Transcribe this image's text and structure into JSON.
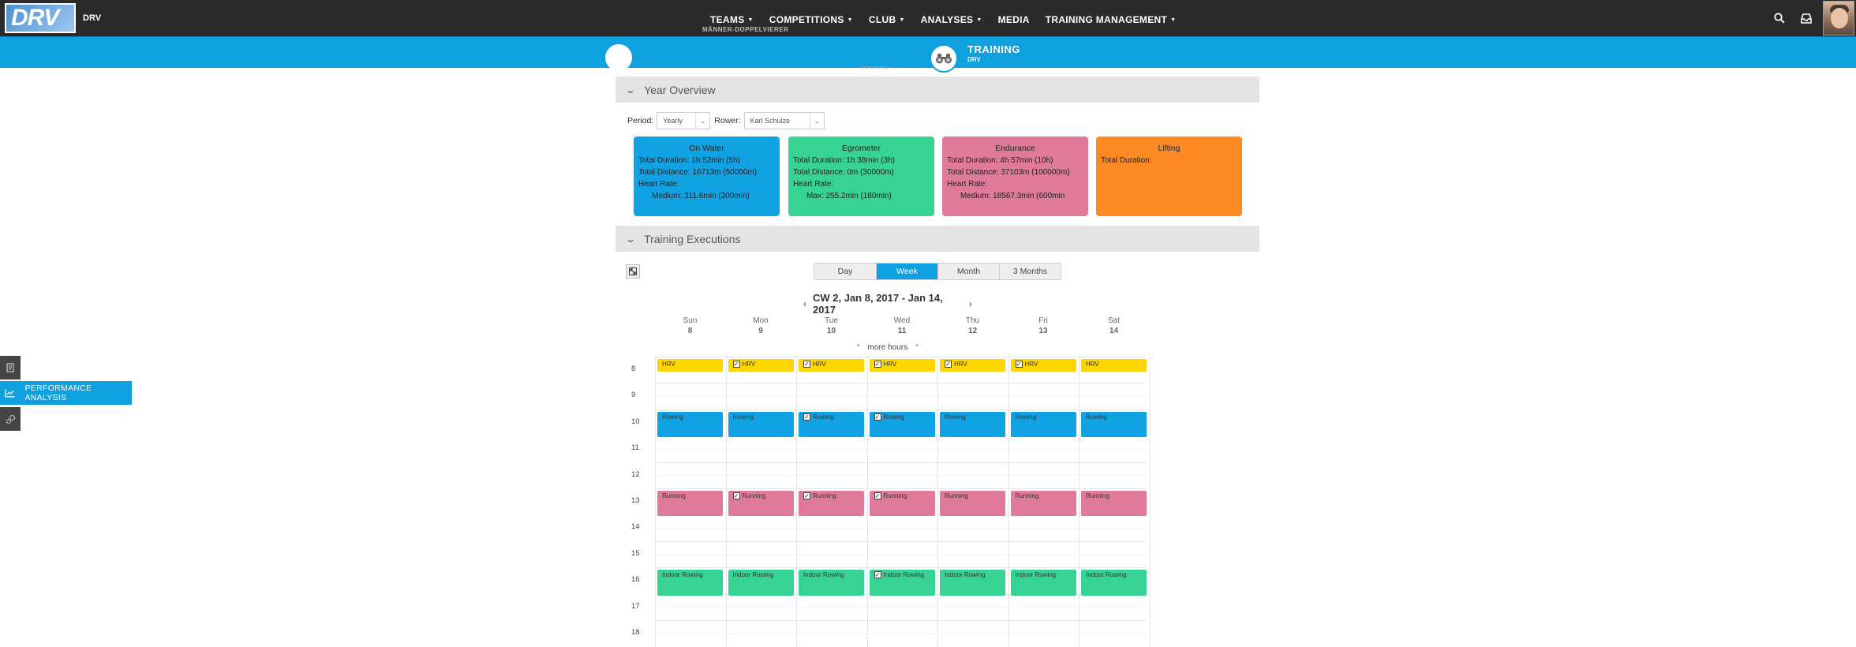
{
  "header": {
    "logo_text": "DRV",
    "brand": "DRV",
    "nav": [
      {
        "label": "TEAMS",
        "caret": true,
        "sub": "MÄNNER-DOPPELVIERER"
      },
      {
        "label": "COMPETITIONS",
        "caret": true
      },
      {
        "label": "CLUB",
        "caret": true
      },
      {
        "label": "ANALYSES",
        "caret": true
      },
      {
        "label": "MEDIA",
        "caret": false
      },
      {
        "label": "TRAINING MANAGEMENT",
        "caret": true
      }
    ],
    "caret_glyph": "▼"
  },
  "bluebar": {
    "title": "TRAINING",
    "subtitle": "DRV",
    "cut_text": "TRAINING"
  },
  "year_overview": {
    "heading": "Year Overview",
    "period_label": "Period:",
    "period_value": "Yearly",
    "rower_label": "Rower:",
    "rower_value": "Karl Schulze",
    "cards": [
      {
        "title": "On Water",
        "color": "#10a2e2",
        "lines": [
          "Total Duration:  1h 52min (5h)",
          "Total Distance:  16713m (50000m)",
          "Heart Rate:",
          "Medium: 311.6min (300min)"
        ]
      },
      {
        "title": "Egrometer",
        "color": "#37d394",
        "lines": [
          "Total Duration:  1h 38min (3h)",
          "Total Distance:  0m (30000m)",
          "Heart Rate:",
          "Max: 255.2min (180min)"
        ]
      },
      {
        "title": "Endurance",
        "color": "#e07a9a",
        "lines": [
          "Total Duration:  4h 57min (10h)",
          "Total Distance:  37103m (100000m)",
          "Heart Rate:",
          "Medium: 18567.3min (600min"
        ]
      },
      {
        "title": "Lifting",
        "color": "#fd8a22",
        "lines": [
          "Total Duration:",
          "",
          "",
          ""
        ]
      }
    ]
  },
  "executions": {
    "heading": "Training Executions",
    "views": [
      "Day",
      "Week",
      "Month",
      "3 Months"
    ],
    "active_view": "Week",
    "range": "CW 2, Jan 8, 2017 - Jan 14, 2017",
    "more_hours": "more hours",
    "days": [
      {
        "name": "Sun",
        "num": "8"
      },
      {
        "name": "Mon",
        "num": "9"
      },
      {
        "name": "Tue",
        "num": "10"
      },
      {
        "name": "Wed",
        "num": "11"
      },
      {
        "name": "Thu",
        "num": "12"
      },
      {
        "name": "Fri",
        "num": "13"
      },
      {
        "name": "Sat",
        "num": "14"
      }
    ],
    "hours": [
      "8",
      "9",
      "10",
      "11",
      "12",
      "13",
      "14",
      "15",
      "16",
      "17",
      "18"
    ],
    "event_types": {
      "HRV": {
        "color": "#ffd500",
        "hour": 8,
        "span": 0.5
      },
      "Rowing": {
        "color": "#10a2e2",
        "hour": 10,
        "span": 1
      },
      "Running": {
        "color": "#e07a9a",
        "hour": 13,
        "span": 1
      },
      "Indoor Rowing": {
        "color": "#37d394",
        "hour": 16,
        "span": 1
      }
    },
    "checked": {
      "HRV": [
        false,
        true,
        true,
        true,
        true,
        true,
        false
      ],
      "Rowing": [
        false,
        false,
        true,
        true,
        false,
        false,
        false
      ],
      "Running": [
        false,
        true,
        true,
        true,
        false,
        false,
        false
      ],
      "Indoor Rowing": [
        false,
        false,
        false,
        true,
        false,
        false,
        false
      ]
    },
    "check_glyph": "✓"
  },
  "sidebar": {
    "perf_label": "PERFORMANCE ANALYSIS"
  }
}
